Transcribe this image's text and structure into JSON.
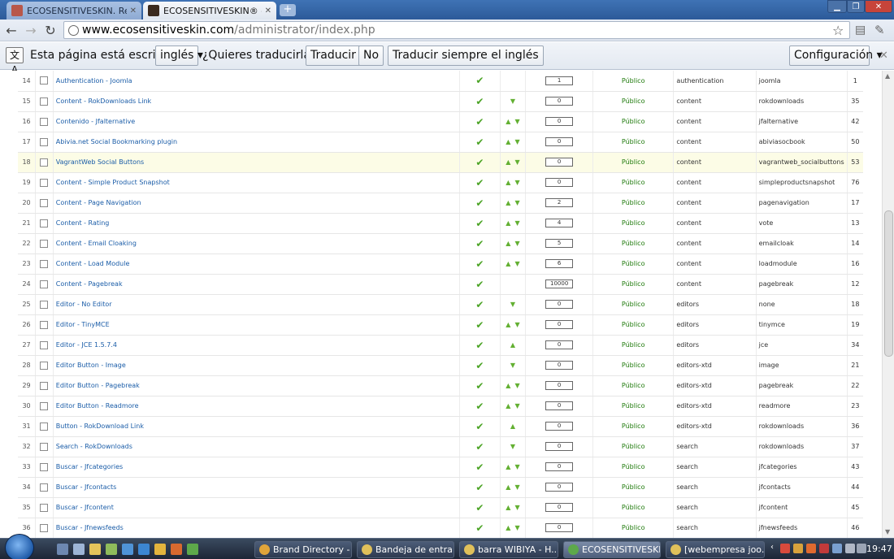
{
  "browser": {
    "tabs": [
      {
        "title": "ECOSENSITIVESKIN. Regalo",
        "active": false
      },
      {
        "title": "ECOSENSITIVESKIN® - Adm",
        "active": true
      }
    ],
    "url_host": "www.ecosensitiveskin.com",
    "url_path": "/administrator/index.php"
  },
  "translate_bar": {
    "text_before": "Esta página está escrita en",
    "language": "inglés",
    "question": "¿Quieres traducirla?",
    "translate_button": "Traducir",
    "no_button": "No",
    "always_button": "Traducir siempre el inglés",
    "config_button": "Configuración"
  },
  "plugins": {
    "rows": [
      {
        "num": "14",
        "name": "Authentication - Joomla",
        "up": false,
        "down": false,
        "order": "1",
        "access": "Público",
        "type": "authentication",
        "element": "joomla",
        "id": "1"
      },
      {
        "num": "15",
        "name": "Content - RokDownloads Link",
        "up": false,
        "down": true,
        "order": "0",
        "access": "Público",
        "type": "content",
        "element": "rokdownloads",
        "id": "35"
      },
      {
        "num": "16",
        "name": "Contenido - Jfalternative",
        "up": true,
        "down": true,
        "order": "0",
        "access": "Público",
        "type": "content",
        "element": "jfalternative",
        "id": "42"
      },
      {
        "num": "17",
        "name": "Abivia.net Social Bookmarking plugin",
        "up": true,
        "down": true,
        "order": "0",
        "access": "Público",
        "type": "content",
        "element": "abiviasocbook",
        "id": "50"
      },
      {
        "num": "18",
        "name": "VagrantWeb Social Buttons",
        "up": true,
        "down": true,
        "order": "0",
        "access": "Público",
        "type": "content",
        "element": "vagrantweb_socialbuttons",
        "id": "53",
        "highlight": true
      },
      {
        "num": "19",
        "name": "Content - Simple Product Snapshot",
        "up": true,
        "down": true,
        "order": "0",
        "access": "Público",
        "type": "content",
        "element": "simpleproductsnapshot",
        "id": "76"
      },
      {
        "num": "20",
        "name": "Content - Page Navigation",
        "up": true,
        "down": true,
        "order": "2",
        "access": "Público",
        "type": "content",
        "element": "pagenavigation",
        "id": "17"
      },
      {
        "num": "21",
        "name": "Content - Rating",
        "up": true,
        "down": true,
        "order": "4",
        "access": "Público",
        "type": "content",
        "element": "vote",
        "id": "13"
      },
      {
        "num": "22",
        "name": "Content - Email Cloaking",
        "up": true,
        "down": true,
        "order": "5",
        "access": "Público",
        "type": "content",
        "element": "emailcloak",
        "id": "14"
      },
      {
        "num": "23",
        "name": "Content - Load Module",
        "up": true,
        "down": true,
        "order": "6",
        "access": "Público",
        "type": "content",
        "element": "loadmodule",
        "id": "16"
      },
      {
        "num": "24",
        "name": "Content - Pagebreak",
        "up": false,
        "down": false,
        "order": "10000",
        "access": "Público",
        "type": "content",
        "element": "pagebreak",
        "id": "12"
      },
      {
        "num": "25",
        "name": "Editor - No Editor",
        "up": false,
        "down": true,
        "order": "0",
        "access": "Público",
        "type": "editors",
        "element": "none",
        "id": "18"
      },
      {
        "num": "26",
        "name": "Editor - TinyMCE",
        "up": true,
        "down": true,
        "order": "0",
        "access": "Público",
        "type": "editors",
        "element": "tinymce",
        "id": "19"
      },
      {
        "num": "27",
        "name": "Editor - JCE 1.5.7.4",
        "up": true,
        "down": false,
        "order": "0",
        "access": "Público",
        "type": "editors",
        "element": "jce",
        "id": "34"
      },
      {
        "num": "28",
        "name": "Editor Button - Image",
        "up": false,
        "down": true,
        "order": "0",
        "access": "Público",
        "type": "editors-xtd",
        "element": "image",
        "id": "21"
      },
      {
        "num": "29",
        "name": "Editor Button - Pagebreak",
        "up": true,
        "down": true,
        "order": "0",
        "access": "Público",
        "type": "editors-xtd",
        "element": "pagebreak",
        "id": "22"
      },
      {
        "num": "30",
        "name": "Editor Button - Readmore",
        "up": true,
        "down": true,
        "order": "0",
        "access": "Público",
        "type": "editors-xtd",
        "element": "readmore",
        "id": "23"
      },
      {
        "num": "31",
        "name": "Button - RokDownload Link",
        "up": true,
        "down": false,
        "order": "0",
        "access": "Público",
        "type": "editors-xtd",
        "element": "rokdownloads",
        "id": "36"
      },
      {
        "num": "32",
        "name": "Search - RokDownloads",
        "up": false,
        "down": true,
        "order": "0",
        "access": "Público",
        "type": "search",
        "element": "rokdownloads",
        "id": "37"
      },
      {
        "num": "33",
        "name": "Buscar - Jfcategories",
        "up": true,
        "down": true,
        "order": "0",
        "access": "Público",
        "type": "search",
        "element": "jfcategories",
        "id": "43"
      },
      {
        "num": "34",
        "name": "Buscar - Jfcontacts",
        "up": true,
        "down": true,
        "order": "0",
        "access": "Público",
        "type": "search",
        "element": "jfcontacts",
        "id": "44"
      },
      {
        "num": "35",
        "name": "Buscar - Jfcontent",
        "up": true,
        "down": true,
        "order": "0",
        "access": "Público",
        "type": "search",
        "element": "jfcontent",
        "id": "45"
      },
      {
        "num": "36",
        "name": "Buscar - Jfnewsfeeds",
        "up": true,
        "down": true,
        "order": "0",
        "access": "Público",
        "type": "search",
        "element": "jfnewsfeeds",
        "id": "46"
      }
    ]
  },
  "taskbar": {
    "tasks": [
      {
        "label": "Brand Directory - ...",
        "active": false
      },
      {
        "label": "Bandeja de entra...",
        "active": false
      },
      {
        "label": "barra WIBIYA - H...",
        "active": false
      },
      {
        "label": "ECOSENSITIVESKI...",
        "active": true
      },
      {
        "label": "[webempresa joo...",
        "active": false
      }
    ],
    "clock": "19:47"
  },
  "colors": {
    "link": "#1b5da8",
    "check": "#4aa324",
    "access": "#1f7a0b",
    "highlight_row": "#fcfce6"
  }
}
